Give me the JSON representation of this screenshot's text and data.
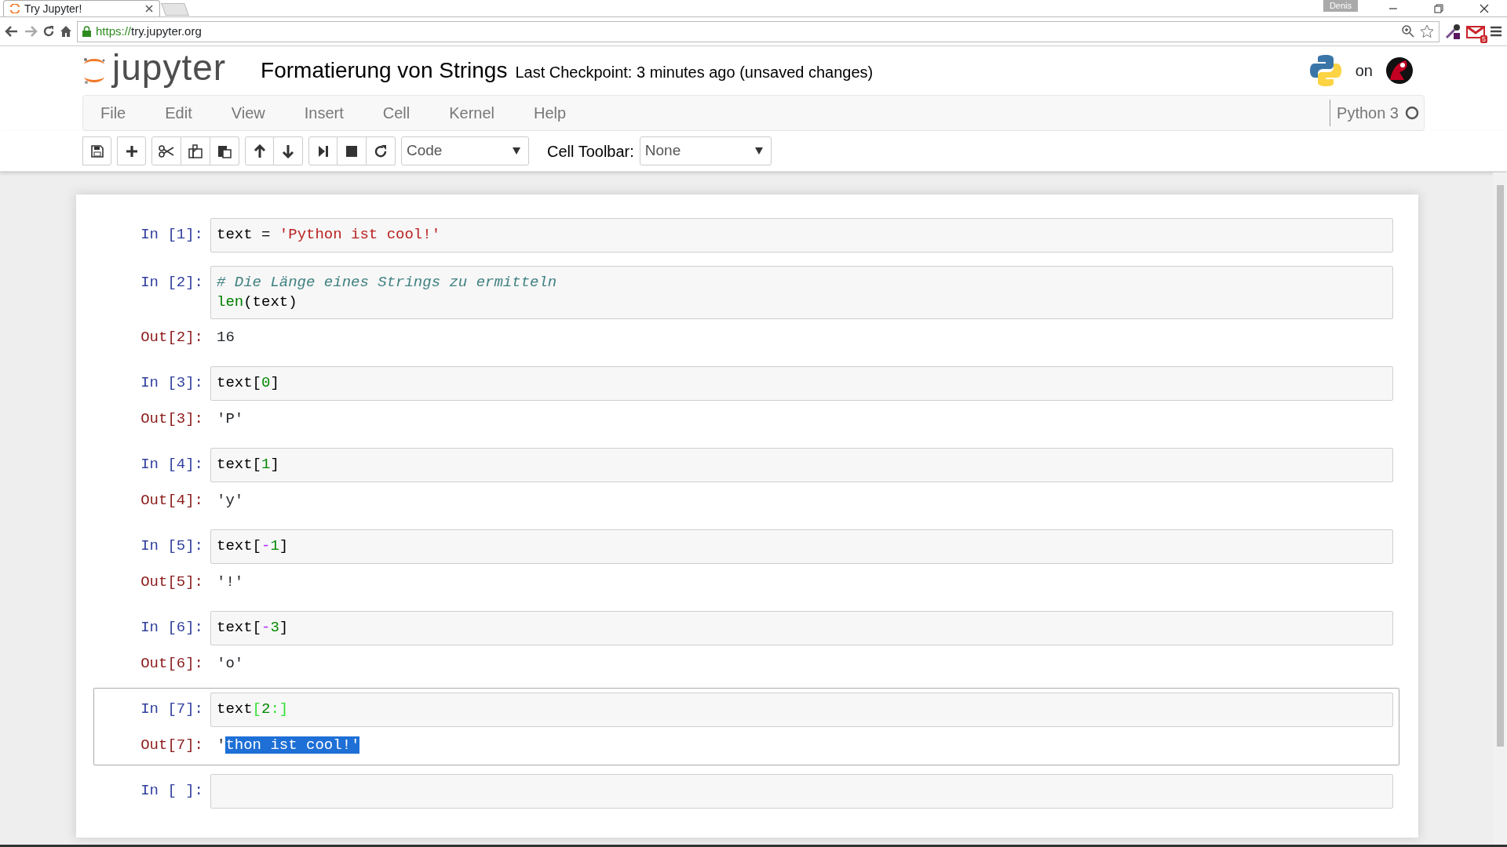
{
  "browser": {
    "tab_title": "Try Jupyter!",
    "url_scheme": "https://",
    "url_host": "try.jupyter.org",
    "profile": "Denis",
    "mail_badge": "5"
  },
  "header": {
    "logo_text": "jupyter",
    "notebook_title": "Formatierung von Strings",
    "checkpoint": "Last Checkpoint: 3 minutes ago (unsaved changes)",
    "on_text": "on"
  },
  "menu": [
    "File",
    "Edit",
    "View",
    "Insert",
    "Cell",
    "Kernel",
    "Help"
  ],
  "kernel": {
    "name": "Python 3",
    "busy": false
  },
  "toolbar": {
    "cell_type": "Code",
    "cell_toolbar_label": "Cell Toolbar:",
    "cell_toolbar_value": "None"
  },
  "cells": [
    {
      "prompt_in": "In [1]:",
      "selected": false,
      "lines": [
        [
          {
            "kind": "name",
            "text": "text"
          },
          {
            "kind": "plain",
            "text": " = "
          },
          {
            "kind": "string",
            "text": "'Python ist cool!'"
          }
        ]
      ]
    },
    {
      "prompt_in": "In [2]:",
      "selected": false,
      "lines": [
        [
          {
            "kind": "comment",
            "text": "# Die Länge eines Strings zu ermitteln"
          }
        ],
        [
          {
            "kind": "builtin",
            "text": "len"
          },
          {
            "kind": "plain",
            "text": "(text)"
          }
        ]
      ],
      "prompt_out": "Out[2]:",
      "output": [
        {
          "text": "16",
          "highlighted": false
        }
      ]
    },
    {
      "prompt_in": "In [3]:",
      "selected": false,
      "lines": [
        [
          {
            "kind": "name",
            "text": "text"
          },
          {
            "kind": "plain",
            "text": "["
          },
          {
            "kind": "number",
            "text": "0"
          },
          {
            "kind": "plain",
            "text": "]"
          }
        ]
      ],
      "prompt_out": "Out[3]:",
      "output": [
        {
          "text": "'P'",
          "highlighted": false
        }
      ]
    },
    {
      "prompt_in": "In [4]:",
      "selected": false,
      "lines": [
        [
          {
            "kind": "name",
            "text": "text"
          },
          {
            "kind": "plain",
            "text": "["
          },
          {
            "kind": "number",
            "text": "1"
          },
          {
            "kind": "plain",
            "text": "]"
          }
        ]
      ],
      "prompt_out": "Out[4]:",
      "output": [
        {
          "text": "'y'",
          "highlighted": false
        }
      ]
    },
    {
      "prompt_in": "In [5]:",
      "selected": false,
      "lines": [
        [
          {
            "kind": "name",
            "text": "text"
          },
          {
            "kind": "plain",
            "text": "["
          },
          {
            "kind": "operator",
            "text": "-"
          },
          {
            "kind": "number",
            "text": "1"
          },
          {
            "kind": "plain",
            "text": "]"
          }
        ]
      ],
      "prompt_out": "Out[5]:",
      "output": [
        {
          "text": "'!'",
          "highlighted": false
        }
      ]
    },
    {
      "prompt_in": "In [6]:",
      "selected": false,
      "lines": [
        [
          {
            "kind": "name",
            "text": "text"
          },
          {
            "kind": "plain",
            "text": "["
          },
          {
            "kind": "operator",
            "text": "-"
          },
          {
            "kind": "number",
            "text": "3"
          },
          {
            "kind": "plain",
            "text": "]"
          }
        ]
      ],
      "prompt_out": "Out[6]:",
      "output": [
        {
          "text": "'o'",
          "highlighted": false
        }
      ]
    },
    {
      "prompt_in": "In [7]:",
      "selected": true,
      "lines": [
        [
          {
            "kind": "name",
            "text": "text"
          },
          {
            "kind": "match",
            "text": "["
          },
          {
            "kind": "number",
            "text": "2"
          },
          {
            "kind": "match",
            "text": ":]"
          }
        ]
      ],
      "prompt_out": "Out[7]:",
      "output": [
        {
          "text": "'",
          "highlighted": false
        },
        {
          "text": "thon ist cool!'",
          "highlighted": true
        }
      ]
    },
    {
      "prompt_in": "In [ ]:",
      "selected": false
    }
  ]
}
